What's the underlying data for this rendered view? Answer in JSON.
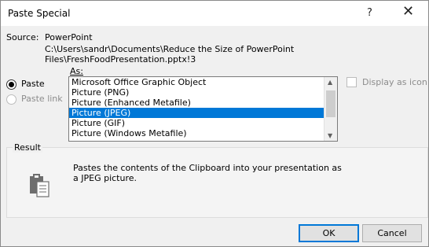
{
  "window": {
    "title": "Paste Special",
    "help_label": "?",
    "close_label": "✕"
  },
  "source": {
    "label": "Source:",
    "app": "PowerPoint",
    "path_line1": "C:\\Users\\sandr\\Documents\\Reduce the Size of PowerPoint",
    "path_line2": "Files\\FreshFoodPresentation.pptx!3"
  },
  "paste_mode": {
    "paste_label": "Paste",
    "paste_link_label": "Paste link",
    "selected": "Paste"
  },
  "as_list": {
    "label": "As:",
    "items": [
      "Microsoft Office Graphic Object",
      "Picture (PNG)",
      "Picture (Enhanced Metafile)",
      "Picture (JPEG)",
      "Picture (GIF)",
      "Picture (Windows Metafile)"
    ],
    "selected_index": 3
  },
  "display_as_icon": {
    "label": "Display as icon",
    "checked": false,
    "enabled": false
  },
  "result": {
    "title": "Result",
    "line1": "Pastes the contents of the Clipboard into your presentation as",
    "line2": "a JPEG picture.",
    "icon": "clipboard-paste-icon"
  },
  "buttons": {
    "ok": "OK",
    "cancel": "Cancel"
  },
  "colors": {
    "selection": "#0078d7",
    "disabled_text": "#8c8c8c"
  }
}
